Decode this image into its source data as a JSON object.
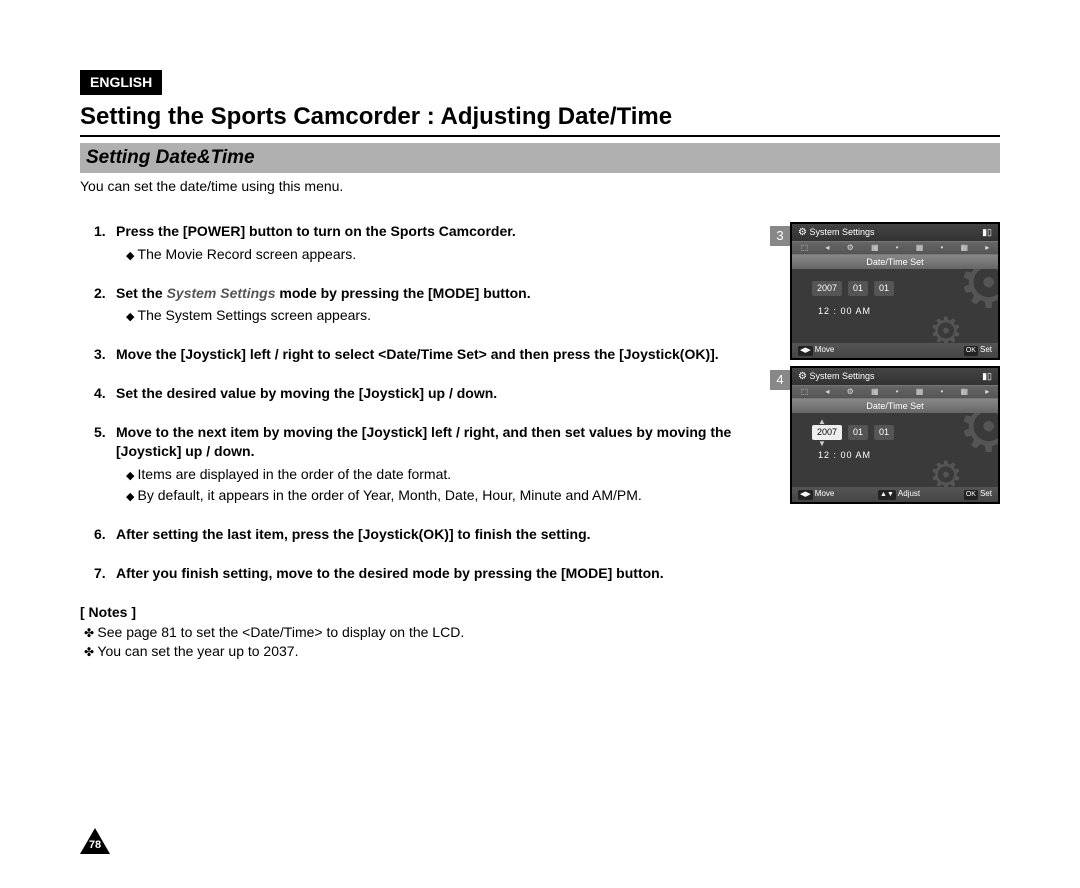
{
  "language_badge": "ENGLISH",
  "title": "Setting the Sports Camcorder : Adjusting Date/Time",
  "subtitle": "Setting Date&Time",
  "intro": "You can set the date/time using this menu.",
  "steps": [
    {
      "text": "Press the [POWER] button to turn on the Sports Camcorder.",
      "sub": [
        "The Movie Record screen appears."
      ]
    },
    {
      "prefix": "Set the ",
      "italic": "System Settings",
      "suffix": " mode by pressing the [MODE] button.",
      "sub": [
        "The System Settings screen appears."
      ]
    },
    {
      "text": "Move the [Joystick] left / right to select <Date/Time Set> and then press the [Joystick(OK)].",
      "sub": []
    },
    {
      "text": "Set the desired value by moving the [Joystick] up / down.",
      "sub": []
    },
    {
      "text": "Move to the next item by moving the [Joystick] left / right, and then set values by moving the [Joystick] up / down.",
      "sub": [
        "Items are displayed in the order of the date format.",
        "By default, it appears in the order of Year, Month, Date, Hour, Minute and AM/PM."
      ]
    },
    {
      "text": "After setting the last item, press the [Joystick(OK)] to finish the setting.",
      "sub": []
    },
    {
      "text": "After you finish setting, move to the desired mode by pressing the [MODE] button.",
      "sub": []
    }
  ],
  "notes_header": "[ Notes ]",
  "notes": [
    "See page 81 to set the <Date/Time> to display on the LCD.",
    "You can set the year up to 2037."
  ],
  "page_number": "78",
  "screens": {
    "s3": {
      "num": "3",
      "title": "System Settings",
      "section": "Date/Time Set",
      "year": "2007",
      "month": "01",
      "day": "01",
      "time": "12 : 00  AM",
      "footer_left_key": "◀▶",
      "footer_left": "Move",
      "footer_right_key": "OK",
      "footer_right": "Set"
    },
    "s4": {
      "num": "4",
      "title": "System Settings",
      "section": "Date/Time Set",
      "year": "2007",
      "month": "01",
      "day": "01",
      "time": "12 : 00  AM",
      "footer_a_key": "◀▶",
      "footer_a": "Move",
      "footer_b_key": "▲▼",
      "footer_b": "Adjust",
      "footer_c_key": "OK",
      "footer_c": "Set"
    }
  }
}
